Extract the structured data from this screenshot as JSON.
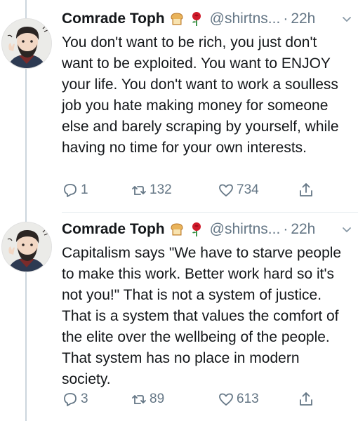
{
  "tweets": [
    {
      "author_name": "Comrade Toph",
      "handle": "@shirtns...",
      "separator": "·",
      "time": "22h",
      "text": "You don't want to be rich, you just don't want to be exploited. You want to ENJOY your life. You don't want to work a soulless job you hate making money for someone else and barely scraping by yourself, while having no time for your own interests.",
      "reply_count": "1",
      "retweet_count": "132",
      "like_count": "734",
      "icons": [
        "bread-emoji-icon",
        "rose-emoji-icon",
        "chevron-down-icon",
        "reply-icon",
        "retweet-icon",
        "like-icon",
        "share-icon"
      ]
    },
    {
      "author_name": "Comrade Toph",
      "handle": "@shirtns...",
      "separator": "·",
      "time": "22h",
      "text": "Capitalism says \"We have to starve people to make this work. Better work hard so it's not you!\" That is not a system of justice. That is a system that values the comfort of the elite over the wellbeing of the people. That system has no place in modern society.",
      "reply_count": "3",
      "retweet_count": "89",
      "like_count": "613",
      "icons": [
        "bread-emoji-icon",
        "rose-emoji-icon",
        "chevron-down-icon",
        "reply-icon",
        "retweet-icon",
        "like-icon",
        "share-icon"
      ]
    }
  ],
  "colors": {
    "text": "#14171a",
    "secondary": "#657786",
    "thread_line": "#ccd6dd"
  }
}
